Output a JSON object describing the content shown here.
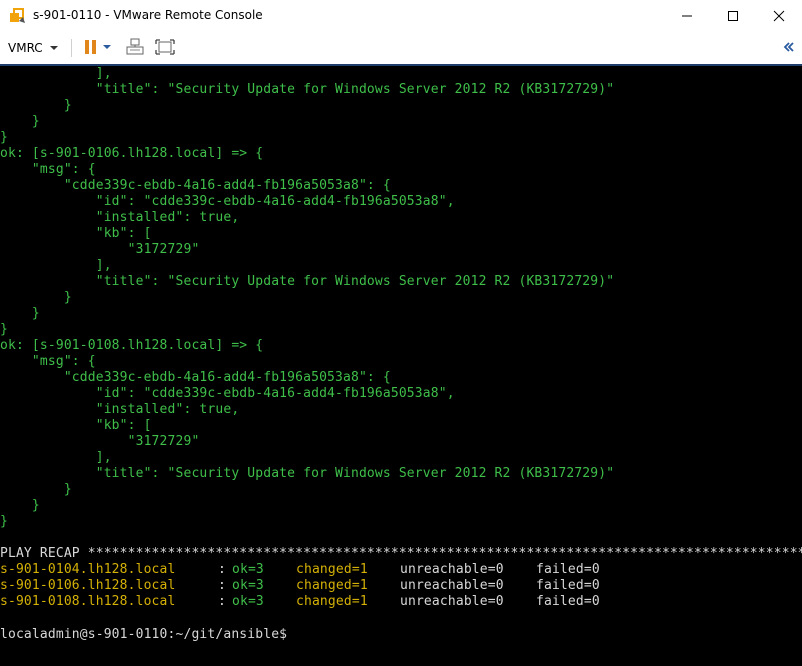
{
  "window": {
    "title": "s-901-0110 - VMware Remote Console"
  },
  "toolbar": {
    "vmrc_label": "VMRC",
    "icons": [
      "pause-icon",
      "send-ctrl-alt-del-icon",
      "fullscreen-icon",
      "collapse-icon"
    ]
  },
  "console": {
    "lines": [
      {
        "text": "            ],",
        "color": "g"
      },
      {
        "text": "            \"title\": \"Security Update for Windows Server 2012 R2 (KB3172729)\"",
        "color": "g"
      },
      {
        "text": "        }",
        "color": "g"
      },
      {
        "text": "    }",
        "color": "g"
      },
      {
        "text": "}",
        "color": "g"
      },
      {
        "text": "ok: [s-901-0106.lh128.local] => {",
        "color": "g"
      },
      {
        "text": "    \"msg\": {",
        "color": "g"
      },
      {
        "text": "        \"cdde339c-ebdb-4a16-add4-fb196a5053a8\": {",
        "color": "g"
      },
      {
        "text": "            \"id\": \"cdde339c-ebdb-4a16-add4-fb196a5053a8\",",
        "color": "g"
      },
      {
        "text": "            \"installed\": true,",
        "color": "g"
      },
      {
        "text": "            \"kb\": [",
        "color": "g"
      },
      {
        "text": "                \"3172729\"",
        "color": "g"
      },
      {
        "text": "            ],",
        "color": "g"
      },
      {
        "text": "            \"title\": \"Security Update for Windows Server 2012 R2 (KB3172729)\"",
        "color": "g"
      },
      {
        "text": "        }",
        "color": "g"
      },
      {
        "text": "    }",
        "color": "g"
      },
      {
        "text": "}",
        "color": "g"
      },
      {
        "text": "ok: [s-901-0108.lh128.local] => {",
        "color": "g"
      },
      {
        "text": "    \"msg\": {",
        "color": "g"
      },
      {
        "text": "        \"cdde339c-ebdb-4a16-add4-fb196a5053a8\": {",
        "color": "g"
      },
      {
        "text": "            \"id\": \"cdde339c-ebdb-4a16-add4-fb196a5053a8\",",
        "color": "g"
      },
      {
        "text": "            \"installed\": true,",
        "color": "g"
      },
      {
        "text": "            \"kb\": [",
        "color": "g"
      },
      {
        "text": "                \"3172729\"",
        "color": "g"
      },
      {
        "text": "            ],",
        "color": "g"
      },
      {
        "text": "            \"title\": \"Security Update for Windows Server 2012 R2 (KB3172729)\"",
        "color": "g"
      },
      {
        "text": "        }",
        "color": "g"
      },
      {
        "text": "    }",
        "color": "g"
      },
      {
        "text": "}",
        "color": "g"
      },
      {
        "text": "",
        "color": "w"
      },
      {
        "text": "PLAY RECAP *****************************************************************************************************",
        "color": "w"
      }
    ],
    "recap": [
      {
        "host": "s-901-0104.lh128.local",
        "ok": "ok=3",
        "changed": "changed=1",
        "unreachable": "unreachable=0",
        "failed": "failed=0"
      },
      {
        "host": "s-901-0106.lh128.local",
        "ok": "ok=3",
        "changed": "changed=1",
        "unreachable": "unreachable=0",
        "failed": "failed=0"
      },
      {
        "host": "s-901-0108.lh128.local",
        "ok": "ok=3",
        "changed": "changed=1",
        "unreachable": "unreachable=0",
        "failed": "failed=0"
      }
    ],
    "recap_separator": ":",
    "prompt": "localadmin@s-901-0110:~/git/ansible$",
    "colors": {
      "background": "#000000",
      "green": "#3fbf4a",
      "yellow": "#d4b106",
      "white": "#d8d8d8"
    }
  }
}
